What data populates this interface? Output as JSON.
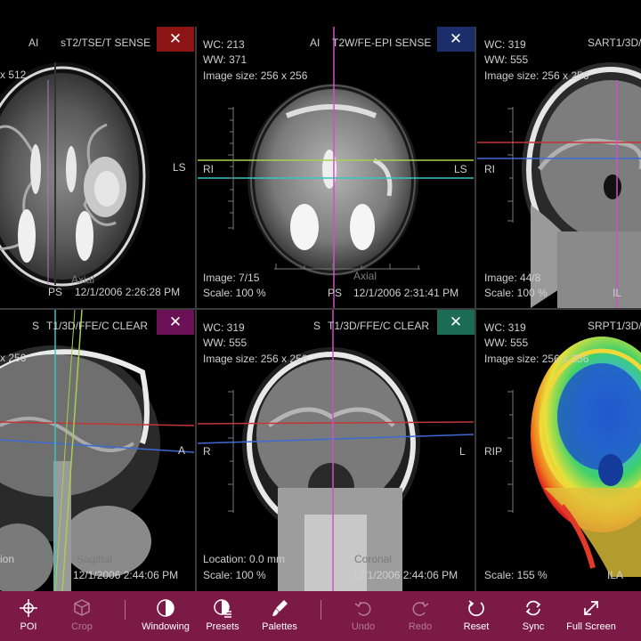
{
  "viewports": [
    {
      "series": "sT2/TSE/T SENSE",
      "orient_prefix": "AI",
      "size_fragment": "x 512",
      "right_label": "LS",
      "view": "Axial",
      "bottom_orient": "PS",
      "timestamp": "12/1/2006 2:26:28 PM",
      "close_color": "#8b1414"
    },
    {
      "wc": "WC: 213",
      "ww": "WW: 371",
      "orient_prefix": "AI",
      "series": "T2W/FE-EPI SENSE",
      "image_size": "Image size: 256 x 256",
      "left_label": "RI",
      "right_label": "LS",
      "image": "Image: 7/15",
      "scale": "Scale: 100 %",
      "view": "Axial",
      "bottom_orient": "PS",
      "timestamp": "12/1/2006 2:31:41 PM",
      "close_color": "#1b2d6b"
    },
    {
      "wc": "WC: 319",
      "ww": "WW: 555",
      "series": "SART1/3D/",
      "image_size": "Image size: 256 x 256",
      "left_label": "RI",
      "image": "Image: 44/8",
      "scale": "Scale: 100 %",
      "bottom_orient": "IL"
    },
    {
      "orient_prefix": "S",
      "series": "T1/3D/FFE/C CLEAR",
      "size_fragment": "x 256",
      "right_label": "A",
      "view": "Sagittal",
      "bottom_left": "ion",
      "timestamp": "12/1/2006 2:44:06 PM",
      "close_color": "#6b1257"
    },
    {
      "wc": "WC: 319",
      "ww": "WW: 555",
      "orient_prefix": "S",
      "series": "T1/3D/FFE/C CLEAR",
      "image_size": "Image size: 256 x 256",
      "left_label": "R",
      "right_label": "L",
      "location": "Location: 0.0 mm",
      "scale": "Scale: 100 %",
      "view": "Coronal",
      "timestamp": "12/1/2006 2:44:06 PM",
      "close_color": "#1b6b55"
    },
    {
      "wc": "WC: 319",
      "ww": "WW: 555",
      "series": "SRPT1/3D/",
      "image_size": "Image size: 256 x 256",
      "left_label": "RIP",
      "scale": "Scale: 155 %",
      "bottom_orient": "ILA"
    }
  ],
  "close_glyph": "✕",
  "toolbar": {
    "items": [
      {
        "label": "POI",
        "icon": "crosshair-icon",
        "enabled": true
      },
      {
        "label": "Crop",
        "icon": "crop-cube-icon",
        "enabled": false
      },
      {
        "label": "Windowing",
        "icon": "contrast-icon",
        "enabled": true
      },
      {
        "label": "Presets",
        "icon": "presets-icon",
        "enabled": true
      },
      {
        "label": "Palettes",
        "icon": "palette-brush-icon",
        "enabled": true
      },
      {
        "label": "Undo",
        "icon": "undo-icon",
        "enabled": false
      },
      {
        "label": "Redo",
        "icon": "redo-icon",
        "enabled": false
      },
      {
        "label": "Reset",
        "icon": "reset-icon",
        "enabled": true
      },
      {
        "label": "Sync",
        "icon": "sync-icon",
        "enabled": true
      },
      {
        "label": "Full Screen",
        "icon": "fullscreen-icon",
        "enabled": true
      }
    ],
    "background": "#7c1a47"
  }
}
